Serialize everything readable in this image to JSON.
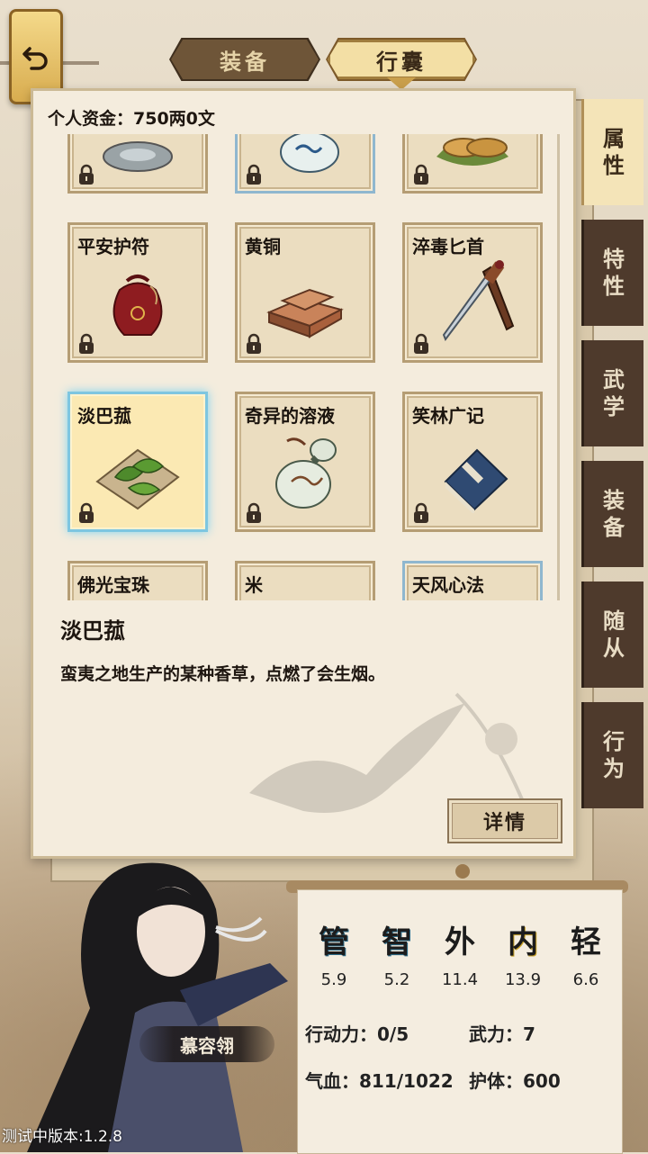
{
  "tabs": {
    "equipment": "装备",
    "bag": "行囊"
  },
  "funds_label": "个人资金：750两0文",
  "items": [
    {
      "name": "",
      "icon": "porcelain-bowl-icon"
    },
    {
      "name": "",
      "icon": "porcelain-cup-icon"
    },
    {
      "name": "",
      "icon": "cakes-icon"
    },
    {
      "name": "平安护符",
      "icon": "amulet-pouch-icon"
    },
    {
      "name": "黄铜",
      "icon": "brass-ingot-icon"
    },
    {
      "name": "淬毒匕首",
      "icon": "dagger-icon"
    },
    {
      "name": "淡巴菰",
      "icon": "tobacco-leaf-icon"
    },
    {
      "name": "奇异的溶液",
      "icon": "gourd-bottle-icon"
    },
    {
      "name": "笑林广记",
      "icon": "book-icon"
    },
    {
      "name": "佛光宝珠",
      "icon": "pearl-icon"
    },
    {
      "name": "米",
      "icon": "rice-icon"
    },
    {
      "name": "天风心法",
      "icon": "scroll-icon"
    }
  ],
  "selected": {
    "name": "淡巴菰",
    "description": "蛮夷之地生产的某种香草，点燃了会生烟。"
  },
  "detail_button": "详情",
  "side_tabs": [
    {
      "line1": "属",
      "line2": "性"
    },
    {
      "line1": "特",
      "line2": "性"
    },
    {
      "line1": "武",
      "line2": "学"
    },
    {
      "line1": "装",
      "line2": "备"
    },
    {
      "line1": "随",
      "line2": "从"
    },
    {
      "line1": "行",
      "line2": "为"
    }
  ],
  "character": {
    "name": "慕容翎"
  },
  "attributes": [
    {
      "label": "管",
      "value": "5.9",
      "color": "#2d6e8c"
    },
    {
      "label": "智",
      "value": "5.2",
      "color": "#2d6e8c"
    },
    {
      "label": "外",
      "value": "11.4",
      "color": "#222222"
    },
    {
      "label": "内",
      "value": "13.9",
      "color": "#c9a227"
    },
    {
      "label": "轻",
      "value": "6.6",
      "color": "#222222"
    }
  ],
  "stats": {
    "action_points": "行动力：0/5",
    "force": "武力：7",
    "hp": "气血：811/1022",
    "armor": "护体：600"
  },
  "version": "测试中版本:1.2.8"
}
